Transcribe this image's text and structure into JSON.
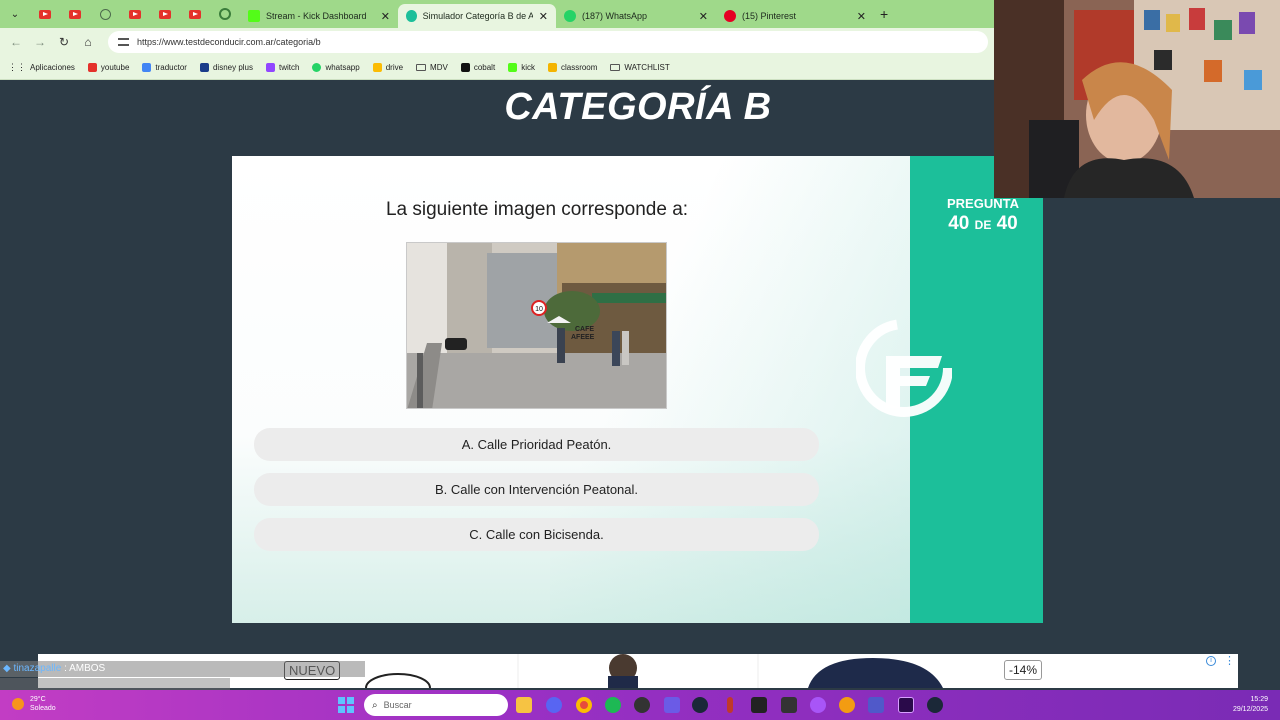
{
  "browser": {
    "tabs": [
      {
        "label": "Stream - Kick Dashboard",
        "color": "#53fc18"
      },
      {
        "label": "Simulador Categoría B de Arge",
        "color": "#1cbf9a",
        "active": true
      },
      {
        "label": "(187) WhatsApp",
        "color": "#25d366"
      },
      {
        "label": "(15) Pinterest",
        "color": "#e60023"
      }
    ],
    "url": "https://www.testdeconducir.com.ar/categoria/b",
    "bookmarks": [
      {
        "label": "Aplicaciones",
        "icon": "grid-icon"
      },
      {
        "label": "youtube",
        "color": "#e4312b"
      },
      {
        "label": "traductor",
        "color": "#4285f4"
      },
      {
        "label": "disney plus",
        "color": "#1a3c8a"
      },
      {
        "label": "twitch",
        "color": "#9146ff"
      },
      {
        "label": "whatsapp",
        "color": "#25d366"
      },
      {
        "label": "drive",
        "color": "#fbbc04"
      },
      {
        "label": "MDV",
        "icon": "folder-icon"
      },
      {
        "label": "cobalt",
        "color": "#111111"
      },
      {
        "label": "kick",
        "color": "#53fc18"
      },
      {
        "label": "classroom",
        "color": "#f4b400"
      },
      {
        "label": "WATCHLIST",
        "icon": "folder-icon"
      }
    ]
  },
  "page": {
    "title": "CATEGORÍA B",
    "question": "La siguiente imagen corresponde a:",
    "options": [
      "A. Calle Prioridad Peatón.",
      "B. Calle con Intervención Peatonal.",
      "C. Calle con Bicisenda."
    ],
    "progress": {
      "label": "PREGUNTA",
      "current": "40",
      "of": "DE",
      "total": "40"
    },
    "photo_text": {
      "sign": "10",
      "cafe": "CAFE\nAFEEE"
    }
  },
  "overlay": {
    "chat_user": "tinazapalle",
    "chat_message": ": AMBOS"
  },
  "ad": {
    "badge": "NUEVO",
    "discount": "-14%"
  },
  "taskbar": {
    "temp": "29°C",
    "weather": "Soleado",
    "search_placeholder": "Buscar",
    "time": "15:29",
    "date": "29/12/2025"
  },
  "colors": {
    "accent": "#1cbf9a",
    "page_bg": "#2c3a45",
    "tab_bar": "#9fd98a"
  }
}
